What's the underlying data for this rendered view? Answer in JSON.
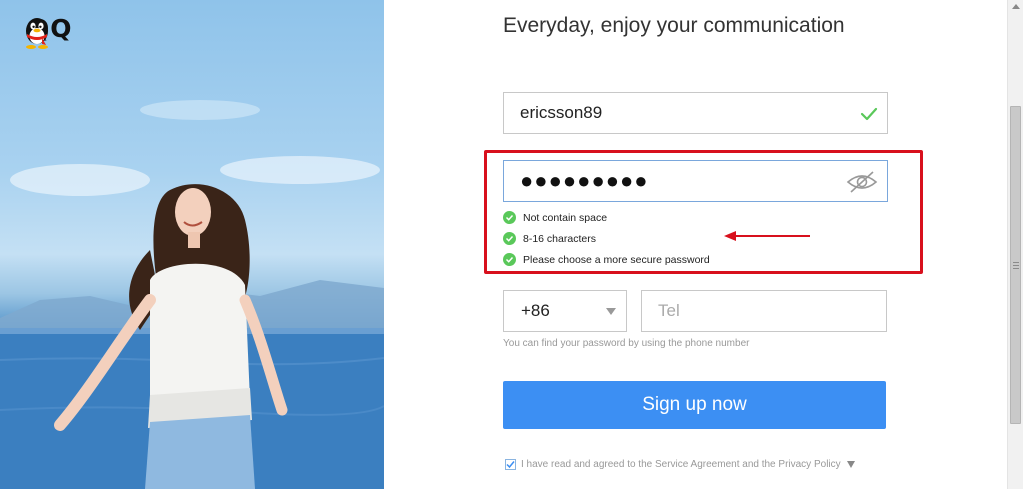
{
  "app": {
    "logo_text": "QQ"
  },
  "form": {
    "headline": "Everyday, enjoy your communication",
    "username_value": "ericsson89",
    "password_value": "●●●●●●●●●",
    "password_rules": [
      {
        "label": "Not contain space"
      },
      {
        "label": "8-16 characters"
      },
      {
        "label": "Please choose a more secure password"
      }
    ],
    "country_code": "+86",
    "tel_placeholder": "Tel",
    "tel_hint": "You can find your password by using the phone number",
    "signup_label": "Sign up now",
    "agreement_text": "I have read and agreed to the Service Agreement and the Privacy Policy"
  },
  "colors": {
    "accent_blue": "#3c8ff3",
    "valid_green": "#5ac85a",
    "annotation_red": "#d8101d"
  }
}
